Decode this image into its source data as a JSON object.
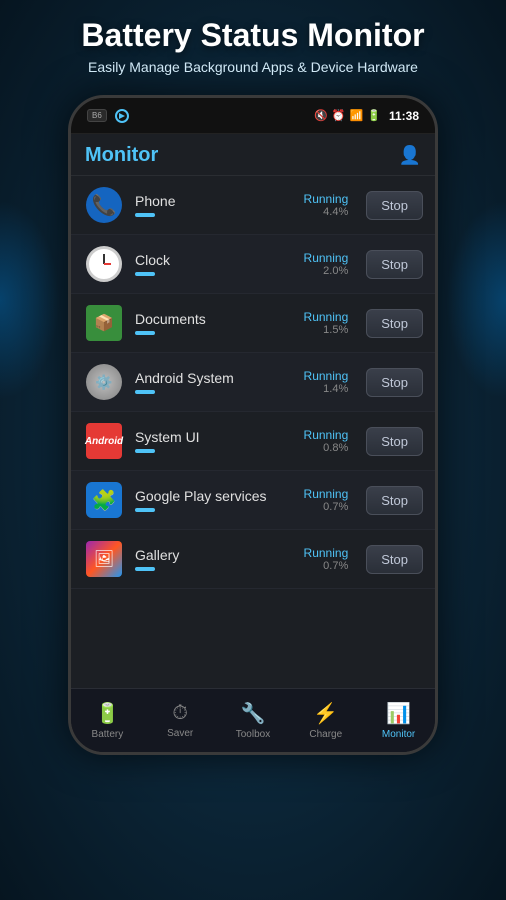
{
  "header": {
    "title": "Battery Status Monitor",
    "subtitle": "Easily Manage Background Apps & Device Hardware"
  },
  "statusBar": {
    "time": "11:38",
    "icons": [
      "🔇",
      "⏰",
      "📶",
      "🔋"
    ]
  },
  "app": {
    "title": "Monitor",
    "apps": [
      {
        "id": "phone",
        "name": "Phone",
        "status": "Running",
        "percent": "4.4%",
        "icon": "phone"
      },
      {
        "id": "clock",
        "name": "Clock",
        "status": "Running",
        "percent": "2.0%",
        "icon": "clock"
      },
      {
        "id": "documents",
        "name": "Documents",
        "status": "Running",
        "percent": "1.5%",
        "icon": "android-green"
      },
      {
        "id": "android-system",
        "name": "Android System",
        "status": "Running",
        "percent": "1.4%",
        "icon": "android-system"
      },
      {
        "id": "system-ui",
        "name": "System UI",
        "status": "Running",
        "percent": "0.8%",
        "icon": "android-logo"
      },
      {
        "id": "google-play",
        "name": "Google Play services",
        "status": "Running",
        "percent": "0.7%",
        "icon": "puzzle"
      },
      {
        "id": "gallery",
        "name": "Gallery",
        "status": "Running",
        "percent": "0.7%",
        "icon": "gallery"
      }
    ],
    "stopLabel": "Stop"
  },
  "bottomNav": [
    {
      "id": "battery",
      "label": "Battery",
      "icon": "🔋",
      "active": false
    },
    {
      "id": "saver",
      "label": "Saver",
      "icon": "⏱",
      "active": false
    },
    {
      "id": "toolbox",
      "label": "Toolbox",
      "icon": "🔧",
      "active": false
    },
    {
      "id": "charge",
      "label": "Charge",
      "icon": "⚡",
      "active": false
    },
    {
      "id": "monitor",
      "label": "Monitor",
      "icon": "📊",
      "active": true
    }
  ]
}
